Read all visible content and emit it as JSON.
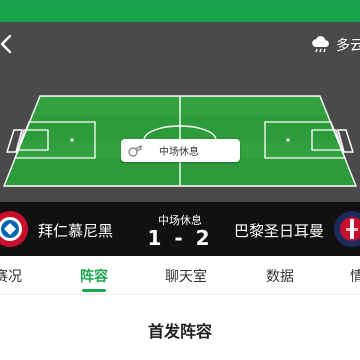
{
  "header": {
    "back_icon": "back-chevron-icon",
    "weather": {
      "icon": "rain-cloud-icon",
      "label": "多云"
    }
  },
  "pitch": {
    "grass_color": "#2d9b3a",
    "line_color": "#ffffff",
    "halftime_pill": {
      "icon": "whistle-icon",
      "label": "中场休息"
    }
  },
  "match": {
    "home_team": {
      "name": "拜仁慕尼黑",
      "logo": "bayern-munich-logo",
      "color": "#c8102e"
    },
    "away_team": {
      "name": "巴黎圣日耳曼",
      "logo": "paris-saint-germain-logo",
      "color": "#1d2b5c"
    },
    "status": "中场休息",
    "score": "1 - 2"
  },
  "tabs": [
    {
      "label": "赛况",
      "active": false
    },
    {
      "label": "阵容",
      "active": true
    },
    {
      "label": "聊天室",
      "active": false
    },
    {
      "label": "数据",
      "active": false
    },
    {
      "label": "情",
      "active": false
    }
  ],
  "section": {
    "title": "首发阵容"
  },
  "colors": {
    "accent": "#1aa64f",
    "status_bar": "#18a34a",
    "scoreboard_bg": "#111111"
  }
}
